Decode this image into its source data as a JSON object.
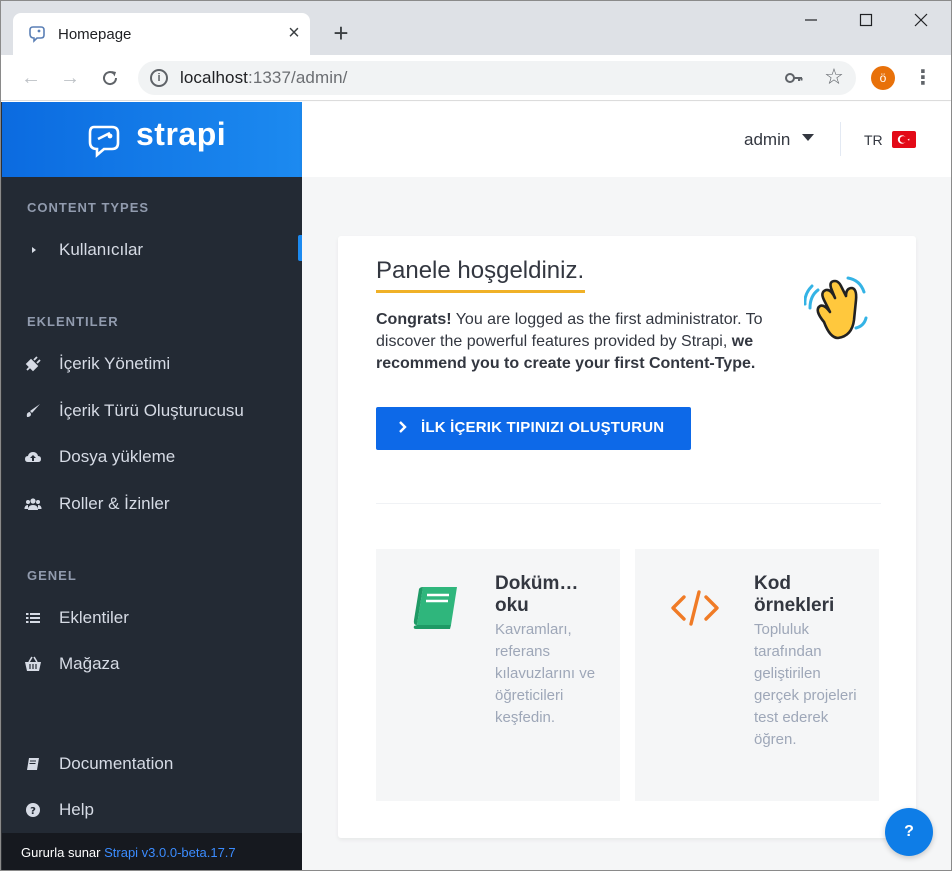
{
  "browser": {
    "tab_title": "Homepage",
    "url_host": "localhost",
    "url_path": ":1337/admin/",
    "profile_initial": "ö"
  },
  "sidebar": {
    "brand": "strapi",
    "sections": [
      {
        "title": "CONTENT TYPES",
        "items": [
          {
            "label": "Kullanıcılar",
            "icon": "caret-right-icon"
          }
        ]
      },
      {
        "title": "EKLENTILER",
        "items": [
          {
            "label": "İçerik Yönetimi",
            "icon": "plug-icon"
          },
          {
            "label": "İçerik Türü Oluşturucusu",
            "icon": "paint-brush-icon"
          },
          {
            "label": "Dosya yükleme",
            "icon": "cloud-upload-icon"
          },
          {
            "label": "Roller & İzinler",
            "icon": "users-icon"
          }
        ]
      },
      {
        "title": "GENEL",
        "items": [
          {
            "label": "Eklentiler",
            "icon": "list-icon"
          },
          {
            "label": "Mağaza",
            "icon": "basket-icon"
          }
        ]
      }
    ],
    "bottom_items": [
      {
        "label": "Documentation",
        "icon": "book-icon"
      },
      {
        "label": "Help",
        "icon": "question-circle-icon"
      }
    ],
    "footer": {
      "prefix": "Gururla sunar",
      "link": "Strapi v3.0.0-beta.17.7"
    }
  },
  "topbar": {
    "user": "admin",
    "lang": "TR"
  },
  "welcome": {
    "title": "Panele hoşgeldiniz.",
    "congrats": "Congrats!",
    "text_1": " You are logged as the first administrator. To discover the powerful features provided by Strapi, ",
    "text_bold": "we recommend you to create your first Content-Type.",
    "cta_label": "İLK İÇERIK TIPINIZI OLUŞTURUN"
  },
  "resources": [
    {
      "title": "Doküm… oku",
      "description": "Kavramları, referans kılavuzlarını ve öğreticileri keşfedin.",
      "icon": "book-icon"
    },
    {
      "title": "Kod örnekleri",
      "description": "Topluluk tarafından geliştirilen gerçek projeleri test ederek öğren.",
      "icon": "code-icon"
    }
  ],
  "help_fab": "?",
  "colors": {
    "brand_blue": "#0d69e8",
    "sidebar_bg": "#232a34",
    "accent_yellow": "#f0b128",
    "doc_icon_green": "#2fb67c",
    "code_icon_orange": "#f07b26"
  }
}
